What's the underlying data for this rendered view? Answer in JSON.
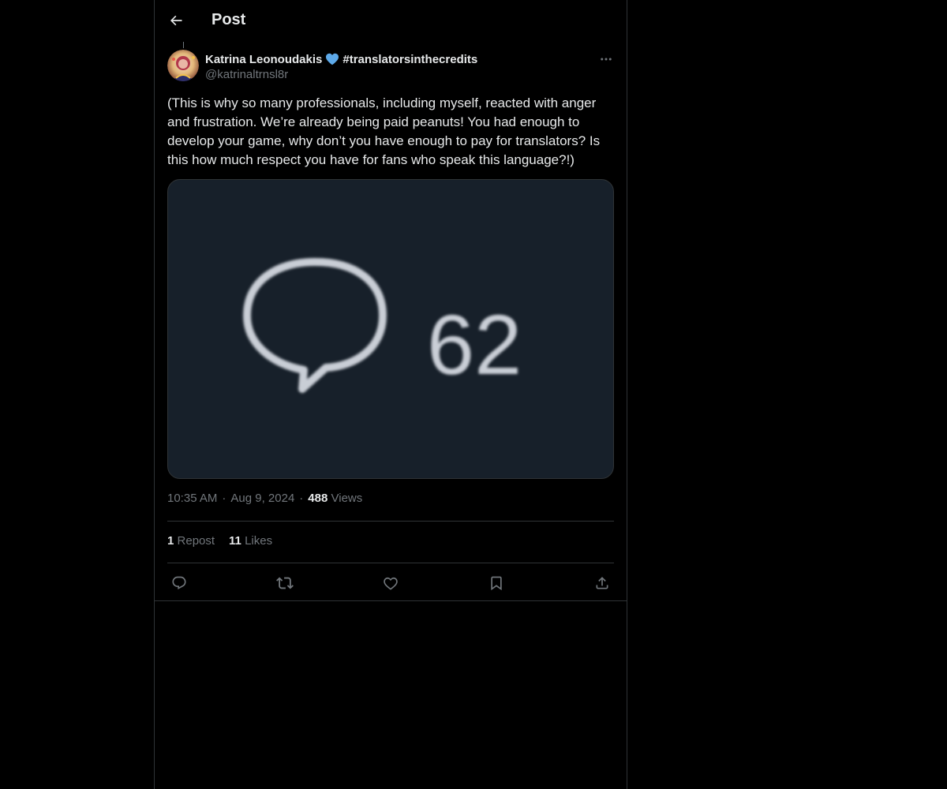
{
  "header": {
    "title": "Post"
  },
  "post": {
    "author_name": "Katrina Leonoudakis",
    "hashtag": "#translatorsinthecredits",
    "handle": "@katrinaltrnsl8r",
    "text": "(This is why so many professionals, including myself, reacted with anger and frustration. We’re already being paid peanuts! You had enough to develop your game, why don’t you have enough to pay for translators? Is this how much respect you have for fans who speak this language?!)",
    "media": {
      "comment_count": "62",
      "icon": "speech-bubble-icon",
      "background": "#17202a"
    },
    "time": "10:35 AM",
    "date": "Aug 9, 2024",
    "views_count": "488",
    "views_label": "Views",
    "reposts_count": "1",
    "reposts_label": "Repost",
    "likes_count": "11",
    "likes_label": "Likes"
  },
  "colors": {
    "background": "#000000",
    "text_primary": "#e7e9ea",
    "text_secondary": "#71767b",
    "border": "#2f3336",
    "heart_blue": "#5da9e9"
  },
  "icons": {
    "back": "arrow-left-icon",
    "more": "more-horizontal-icon",
    "reply": "reply-icon",
    "repost": "repost-icon",
    "like": "heart-icon",
    "bookmark": "bookmark-icon",
    "share": "share-icon"
  }
}
